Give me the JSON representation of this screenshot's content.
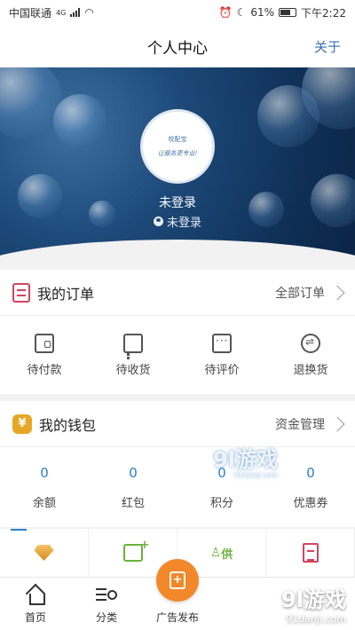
{
  "status_bar": {
    "carrier": "中国联通",
    "network": "4G",
    "battery": "61%",
    "time": "下午2:22"
  },
  "nav": {
    "title": "个人中心",
    "about": "关于"
  },
  "profile": {
    "avatar_top_text": "校配宝",
    "avatar_sub_text": "让服务更专业!",
    "name": "未登录",
    "status": "未登录"
  },
  "orders": {
    "title": "我的订单",
    "all_link": "全部订单",
    "items": [
      {
        "icon": "wallet-icon",
        "label": "待付款"
      },
      {
        "icon": "truck-icon",
        "label": "待收货"
      },
      {
        "icon": "comment-icon",
        "label": "待评价"
      },
      {
        "icon": "refund-icon",
        "label": "退换货"
      }
    ]
  },
  "wallet": {
    "title": "我的钱包",
    "manage_link": "资金管理",
    "items": [
      {
        "value": "0",
        "label": "余额"
      },
      {
        "value": "0",
        "label": "红包"
      },
      {
        "value": "0",
        "label": "积分"
      },
      {
        "value": "0",
        "label": "优惠券"
      }
    ]
  },
  "shortcuts": {
    "supply_label": "供"
  },
  "tabbar": {
    "home": "首页",
    "category": "分类",
    "publish": "广告发布"
  },
  "watermarks": {
    "brand": "9l游戏",
    "domain": "91danji.com"
  },
  "colors": {
    "accent": "#2b7fc4",
    "orange": "#f2882a",
    "red": "#d0455e",
    "green": "#6ab23e"
  }
}
